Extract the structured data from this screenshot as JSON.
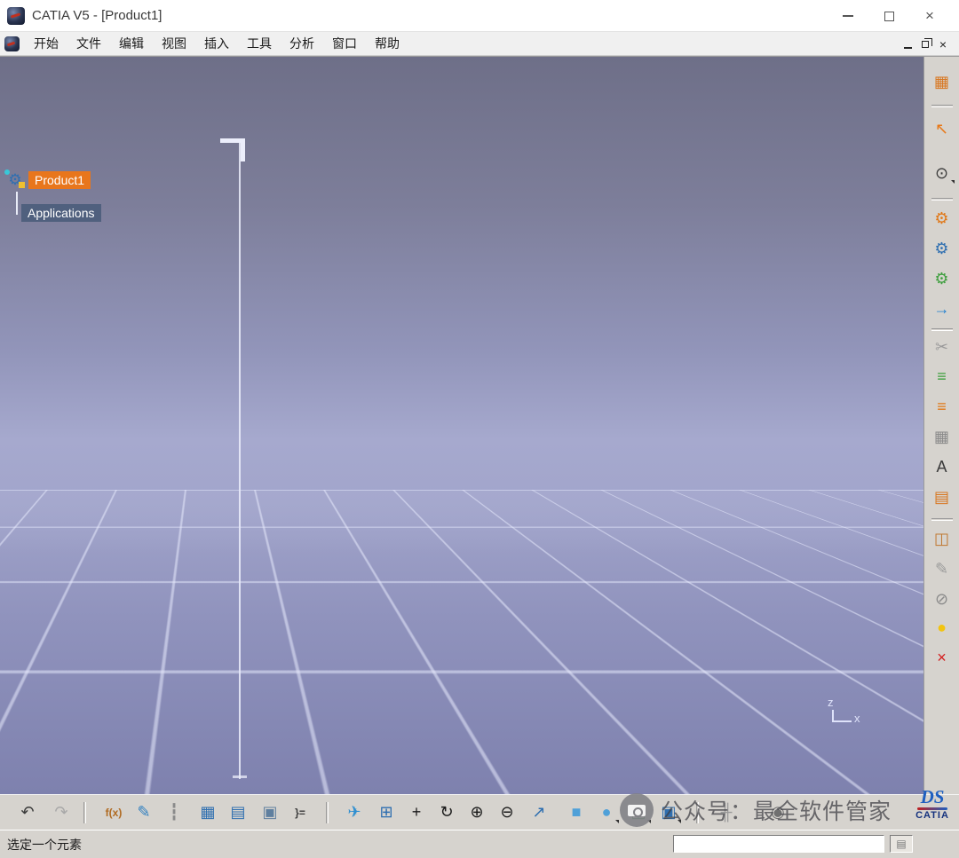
{
  "titlebar": {
    "title": "CATIA V5 - [Product1]",
    "close_glyph": "×"
  },
  "menubar": {
    "close_glyph": "×",
    "items": [
      {
        "name": "menu-start",
        "label": "开始"
      },
      {
        "name": "menu-file",
        "label": "文件"
      },
      {
        "name": "menu-edit",
        "label": "编辑"
      },
      {
        "name": "menu-view",
        "label": "视图"
      },
      {
        "name": "menu-insert",
        "label": "插入"
      },
      {
        "name": "menu-tools",
        "label": "工具"
      },
      {
        "name": "menu-analyze",
        "label": "分析"
      },
      {
        "name": "menu-window",
        "label": "窗口"
      },
      {
        "name": "menu-help",
        "label": "帮助"
      }
    ]
  },
  "tree": {
    "root_label": "Product1",
    "root_icon_glyph": "⚙",
    "child_label": "Applications"
  },
  "axis": {
    "z_label": "z",
    "x_label": "x"
  },
  "right_toolbar": {
    "icons": [
      {
        "name": "workbench-icon",
        "glyph": "▦",
        "color": "#d8761f",
        "gap": 14
      },
      {
        "sep": true,
        "gap": 12
      },
      {
        "name": "select-icon",
        "glyph": "↖",
        "color": "#e87818",
        "gap": 10
      },
      {
        "name": "compass-icon",
        "glyph": "⊙",
        "color": "#3a3a3a",
        "gap": 22,
        "dropdown": true
      },
      {
        "sep": true,
        "gap": 14
      },
      {
        "name": "new-product-icon",
        "glyph": "⚙",
        "color": "#e07818",
        "gap": 6
      },
      {
        "name": "new-component-icon",
        "glyph": "⚙",
        "color": "#2f6fb0",
        "gap": 6
      },
      {
        "name": "new-part-icon",
        "glyph": "⚙",
        "color": "#3f9f3f",
        "gap": 6
      },
      {
        "name": "existing-component-icon",
        "glyph": "→",
        "color": "#1f7fd0",
        "gap": 6
      },
      {
        "sep": true,
        "gap": 8
      },
      {
        "name": "break-link-icon",
        "glyph": "✂",
        "color": "#9a9a9a",
        "gap": 4
      },
      {
        "name": "bom-list-icon",
        "glyph": "≡",
        "color": "#3f9f3f",
        "gap": 5
      },
      {
        "name": "graph-tree-icon",
        "glyph": "≡",
        "color": "#e07818",
        "gap": 6
      },
      {
        "name": "design-table-icon",
        "glyph": "▦",
        "color": "#8a8a8a",
        "gap": 6
      },
      {
        "name": "annotation-icon",
        "glyph": "A",
        "color": "#3a3a3a",
        "gap": 6
      },
      {
        "name": "structure-list-icon",
        "glyph": "▤",
        "color": "#d8761f",
        "gap": 6
      },
      {
        "sep": true,
        "gap": 10
      },
      {
        "name": "scene-frame-icon",
        "glyph": "◫",
        "color": "#c07830",
        "gap": 6
      },
      {
        "name": "sketch-tools-icon",
        "glyph": "✎",
        "color": "#9a9a9a",
        "gap": 6
      },
      {
        "name": "section-icon",
        "glyph": "⊘",
        "color": "#8a8a8a",
        "gap": 6
      },
      {
        "name": "light-on-icon",
        "glyph": "●",
        "color": "#f2c410",
        "gap": 4
      },
      {
        "name": "light-off-icon",
        "glyph": "×",
        "color": "#d42020",
        "gap": 6
      }
    ]
  },
  "bottom_toolbar": {
    "icons": [
      {
        "name": "undo-icon",
        "glyph": "↶",
        "color": "#3a3a3a",
        "gap": 8
      },
      {
        "name": "redo-icon",
        "glyph": "↷",
        "color": "#a8a8a8",
        "gap": 8
      },
      {
        "sep": true,
        "gap": 10
      },
      {
        "name": "formula-icon",
        "glyph": "f(x)",
        "color": "#b06a20",
        "gap": 16
      },
      {
        "name": "knowledge-icon",
        "glyph": "✎",
        "color": "#2f7fc0",
        "gap": 4
      },
      {
        "name": "marker-icon",
        "glyph": "┇",
        "color": "#8a8a8a",
        "gap": 4
      },
      {
        "name": "design-table-icon",
        "glyph": "▦",
        "color": "#2f6fb0",
        "gap": 8
      },
      {
        "name": "structure-graph-icon",
        "glyph": "▤",
        "color": "#2f6fb0",
        "gap": 4
      },
      {
        "name": "catalog-icon",
        "glyph": "▣",
        "color": "#5f7f9f",
        "gap": 6
      },
      {
        "name": "relations-icon",
        "glyph": "}=",
        "color": "#3a3a3a",
        "gap": 4
      },
      {
        "sep": true,
        "gap": 14
      },
      {
        "name": "fly-mode-icon",
        "glyph": "✈",
        "color": "#2f8fd0",
        "gap": 14
      },
      {
        "name": "fit-all-icon",
        "glyph": "⊞",
        "color": "#2f6fb0",
        "gap": 6
      },
      {
        "name": "pan-icon",
        "glyph": "+",
        "color": "#1a1a1a",
        "gap": 4
      },
      {
        "name": "rotate-icon",
        "glyph": "↻",
        "color": "#1a1a1a",
        "gap": 4
      },
      {
        "name": "zoom-in-icon",
        "glyph": "⊕",
        "color": "#1a1a1a",
        "gap": 4
      },
      {
        "name": "zoom-out-icon",
        "glyph": "⊖",
        "color": "#1a1a1a",
        "gap": 4
      },
      {
        "name": "normal-view-icon",
        "glyph": "↗",
        "color": "#2f6fb0",
        "gap": 6
      },
      {
        "name": "iso-view-icon",
        "glyph": "■",
        "color": "#4fa0d8",
        "gap": 12
      },
      {
        "name": "shading-icon",
        "glyph": "●",
        "color": "#4fa0d8",
        "gap": 4,
        "dropdown": true
      },
      {
        "name": "hide-show-icon",
        "glyph": "◫",
        "color": "#3f8f4f",
        "gap": 6,
        "dropdown": true
      },
      {
        "name": "view-mode-icon",
        "glyph": "▣",
        "color": "#2f6fb0",
        "gap": 4,
        "dropdown": true
      },
      {
        "sep": true,
        "gap": 16
      },
      {
        "name": "measure-icon",
        "glyph": "╫",
        "color": "#9a9a9a",
        "gap": 16
      },
      {
        "name": "capture-icon",
        "glyph": "◉",
        "color": "#707070",
        "gap": 28
      }
    ]
  },
  "statusbar": {
    "message": "选定一个元素",
    "field_value": "",
    "aux_icon": "▤"
  },
  "watermark": {
    "text": "公众号：最全软件管家"
  },
  "logo": {
    "ds": "DS",
    "catia": "CATIA"
  },
  "colors": {
    "selection_orange": "#e8761c",
    "tree_child_bg": "#50607e",
    "toolbar_bg": "#d6d3ce"
  }
}
